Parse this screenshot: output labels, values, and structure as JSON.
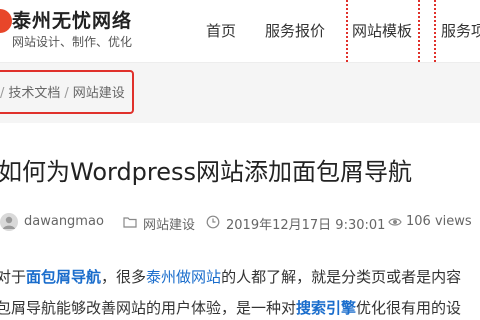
{
  "brand": {
    "title": "泰州无忧网络",
    "subtitle": "网站设计、制作、优化"
  },
  "nav": {
    "items": [
      {
        "label": "首页"
      },
      {
        "label": "服务报价"
      },
      {
        "label": "网站模板"
      },
      {
        "label": "服务项"
      }
    ]
  },
  "breadcrumb": {
    "items": [
      "技术文档",
      "网站建设"
    ],
    "separator": "/"
  },
  "post": {
    "title": "如何为Wordpress网站添加面包屑导航",
    "author": "dawangmao",
    "category": "网站建设",
    "date": "2019年12月17日 9:30:01",
    "views": "106 views"
  },
  "content": {
    "line1": {
      "prefix": "对于",
      "link1": "面包屑导航",
      "mid1": "，很多",
      "link2": "泰州做网站",
      "suffix": "的人都了解，就是分类页或者是内容"
    },
    "line2": {
      "prefix": "包屑导航能够改善网站的用户体验，是一种对",
      "link": "搜索引擎",
      "suffix": "优化很有用的设"
    }
  },
  "colors": {
    "accent_red": "#e0312b",
    "link_blue": "#1a6dcc",
    "logo_red": "#e8462a"
  }
}
